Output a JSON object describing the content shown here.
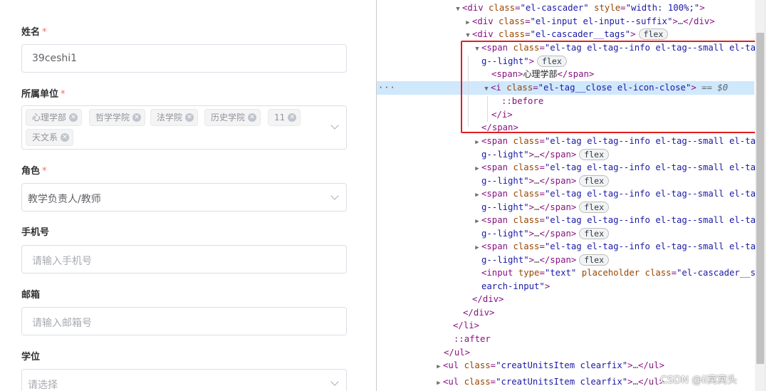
{
  "form": {
    "name_label": "姓名",
    "name_value": "39ceshi1",
    "unit_label": "所属单位",
    "unit_tags": [
      "心理学部",
      "哲学学院",
      "法学院",
      "历史学院",
      "11",
      "天文系"
    ],
    "role_label": "角色",
    "role_value": "教学负责人/教师",
    "phone_label": "手机号",
    "phone_placeholder": "请输入手机号",
    "email_label": "邮箱",
    "email_placeholder": "请输入邮箱号",
    "degree_label": "学位",
    "degree_placeholder": "请选择",
    "required_mark": "*"
  },
  "devtools": {
    "lines": {
      "l0_tag": "div",
      "l0_attr1": "class",
      "l0_val1": "\"el-cascader\"",
      "l0_attr2": "style",
      "l0_val2": "\"width: 100%;\"",
      "l1_tag": "div",
      "l1_attr": "class",
      "l1_val": "\"el-input el-input--suffix\"",
      "l1_close": "div",
      "l2_tag": "div",
      "l2_attr": "class",
      "l2_val": "\"el-cascader__tags\"",
      "l2_badge": "flex",
      "l3_tag": "span",
      "l3_attr": "class",
      "l3_val_a": "\"el-tag el-tag--info el-tag--small el-ta",
      "l4_val_b": "g--light\"",
      "l4_badge": "flex",
      "l5_tag": "span",
      "l5_text": "心理学部",
      "l6_tag": "i",
      "l6_attr": "class",
      "l6_val": "\"el-tag__close el-icon-close\"",
      "l6_eq": "== $0",
      "l7_pseudo": "::before",
      "l8_close": "i",
      "l9_close": "span",
      "collapsed_tag": "span",
      "collapsed_attr": "class",
      "collapsed_val_a": "\"el-tag el-tag--info el-tag--small el-ta",
      "collapsed_val_b": "g--light\"",
      "collapsed_badge": "flex",
      "input_tag": "input",
      "input_attr1": "type",
      "input_val1": "\"text\"",
      "input_attr2": "placeholder",
      "input_attr3": "class",
      "input_val3_a": "\"el-cascader__s",
      "input_val3_b": "earch-input\"",
      "c_div1": "div",
      "c_div2": "div",
      "c_li": "li",
      "after_pseudo": "::after",
      "c_ul": "ul",
      "ul_tag": "ul",
      "ul_attr": "class",
      "ul_val": "\"creatUnitsItem clearfix\"",
      "ul_close": "ul"
    },
    "selected_dots": "···"
  },
  "watermark": "CSDN @ii窝窝头"
}
